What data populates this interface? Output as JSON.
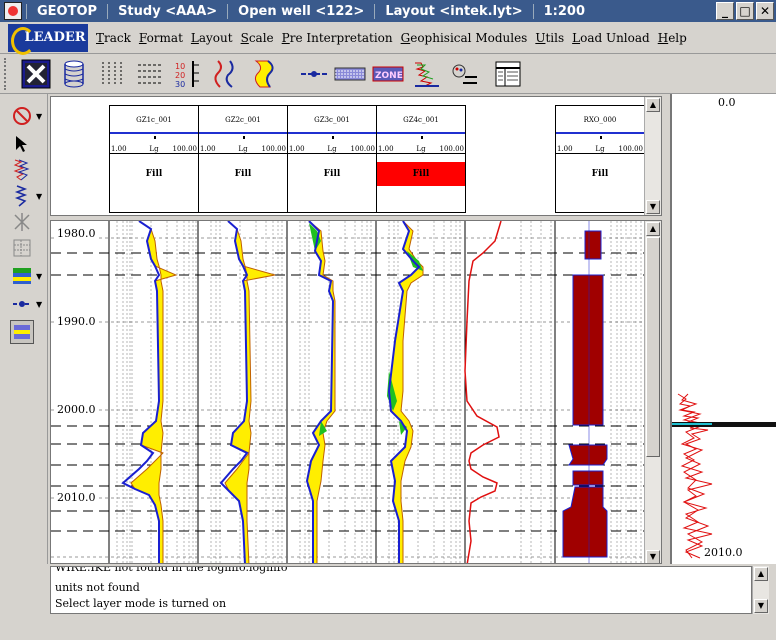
{
  "window": {
    "app_name": "GEOTOP",
    "study": "Study <AAA>",
    "well": "Open well <122>",
    "layout": "Layout <intek.lyt>",
    "scale": "1:200",
    "buttons": {
      "minimize": "_",
      "maximize": "□",
      "close": "✕"
    }
  },
  "logo": {
    "text": "LEADER"
  },
  "menu": [
    {
      "label": "Track",
      "ul": "T",
      "rest": "rack"
    },
    {
      "label": "Format",
      "ul": "F",
      "rest": "ormat"
    },
    {
      "label": "Layout",
      "ul": "L",
      "rest": "ayout"
    },
    {
      "label": "Scale",
      "ul": "S",
      "rest": "cale"
    },
    {
      "label": "Pre Interpretation",
      "ul": "P",
      "rest": "re Interpretation"
    },
    {
      "label": "Geophisical Modules",
      "ul": "G",
      "rest": "eophisical Modules"
    },
    {
      "label": "Utils",
      "ul": "U",
      "rest": "tils"
    },
    {
      "label": "Load Unload",
      "ul": "L",
      "rest": "oad Unload"
    },
    {
      "label": "Help",
      "ul": "H",
      "rest": "elp"
    }
  ],
  "toolbar_icons": [
    "close-track-icon",
    "cylinder-icon",
    "vertical-lines-icon",
    "horizontal-lines-icon",
    "depth-scale-icon",
    "curve-icon",
    "fill-curve-icon",
    "line-marker-icon",
    "pattern-icon",
    "zone-icon",
    "spectrum-icon",
    "paint-icon",
    "table-icon"
  ],
  "toolbar_zone_text": "ZONE",
  "toolbar_scale_text": [
    "10",
    "20",
    "30"
  ],
  "tracks": [
    {
      "name": "GZ1c_001",
      "lo": "1.00",
      "mid": "Lg",
      "hi": "100.00",
      "fill": "Fill",
      "highlight": false
    },
    {
      "name": "GZ2c_001",
      "lo": "1.00",
      "mid": "Lg",
      "hi": "100.00",
      "fill": "Fill",
      "highlight": false
    },
    {
      "name": "GZ3c_001",
      "lo": "1.00",
      "mid": "Lg",
      "hi": "100.00",
      "fill": "Fill",
      "highlight": false
    },
    {
      "name": "GZ4c_001",
      "lo": "1.00",
      "mid": "Lg",
      "hi": "100.00",
      "fill": "Fill",
      "highlight": true
    },
    {
      "name": "RXO_000",
      "lo": "1.00",
      "mid": "Lg",
      "hi": "100.00",
      "fill": "Fill",
      "highlight": false
    }
  ],
  "depths": [
    "1980.0",
    "1990.0",
    "2000.0",
    "2010.0"
  ],
  "overview": {
    "top": "0.0",
    "bottom": "2010.0"
  },
  "messages": [
    "WIRE.IKE not found in the loginfo.loginfo",
    "units  not found",
    "Select layer mode is turned on"
  ],
  "colors": {
    "accent_fill": "#ff0000",
    "curve_blue": "#1a20d0",
    "fill_yellow": "#ffee00",
    "fill_brown": "#c06000",
    "fill_green": "#20c020",
    "dark_red": "#a00000"
  }
}
